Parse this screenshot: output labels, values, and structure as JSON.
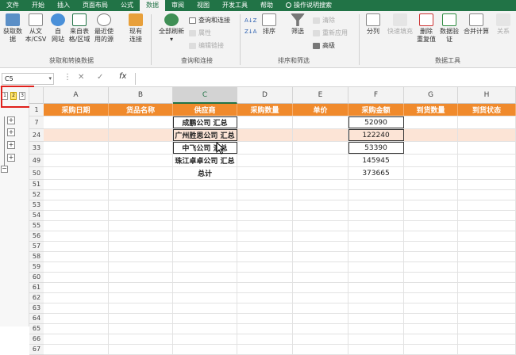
{
  "menu_tabs": [
    {
      "label": "文件",
      "active": false
    },
    {
      "label": "开始",
      "active": false
    },
    {
      "label": "插入",
      "active": false
    },
    {
      "label": "页面布局",
      "active": false
    },
    {
      "label": "公式",
      "active": false
    },
    {
      "label": "数据",
      "active": true
    },
    {
      "label": "审阅",
      "active": false
    },
    {
      "label": "视图",
      "active": false
    },
    {
      "label": "开发工具",
      "active": false
    },
    {
      "label": "帮助",
      "active": false
    }
  ],
  "tell_me": "操作说明搜索",
  "ribbon": {
    "get_data": "获取数\n据",
    "from_csv": "从文\n本/CSV",
    "from_web": "自\n网站",
    "from_table": "来自表\n格/区域",
    "recent_sources": "最近使\n用的源",
    "existing_conn": "现有\n连接",
    "group_get": "获取和转换数据",
    "refresh_all": "全部刷新",
    "queries_conn": "查询和连接",
    "properties": "属性",
    "edit_links": "编辑链接",
    "group_queries": "查询和连接",
    "sort": "排序",
    "filter": "筛选",
    "clear": "清除",
    "reapply": "重新应用",
    "advanced": "高级",
    "group_sort": "排序和筛选",
    "text_to_cols": "分列",
    "flash_fill": "快速填充",
    "remove_dup": "删除\n重复值",
    "data_valid": "数据验\n证",
    "consolidate": "合并计算",
    "relations": "关系",
    "group_tools": "数据工具"
  },
  "namebox": "C5",
  "fx": "fx",
  "outline_levels": [
    "1",
    "2",
    "3"
  ],
  "columns": [
    {
      "letter": "A",
      "selected": false
    },
    {
      "letter": "B",
      "selected": false
    },
    {
      "letter": "C",
      "selected": true
    },
    {
      "letter": "D",
      "selected": false
    },
    {
      "letter": "E",
      "selected": false
    },
    {
      "letter": "F",
      "selected": false
    },
    {
      "letter": "G",
      "selected": false
    },
    {
      "letter": "H",
      "selected": false
    }
  ],
  "headers": [
    "采购日期",
    "货品名称",
    "供应商",
    "采购数量",
    "单价",
    "采购金额",
    "到货数量",
    "到货状态"
  ],
  "summary_rows": [
    {
      "row": "7",
      "supplier": "成鹏公司 汇总",
      "amount": "52090"
    },
    {
      "row": "24",
      "supplier": "广州胜思公司 汇总",
      "amount": "122240"
    },
    {
      "row": "33",
      "supplier": "中飞公司 汇总",
      "amount": "53390"
    },
    {
      "row": "49",
      "supplier": "珠江卓卓公司 汇总",
      "amount": "145945"
    },
    {
      "row": "50",
      "supplier": "总计",
      "amount": "373665"
    }
  ],
  "empty_rows": [
    "51",
    "52",
    "53",
    "54",
    "55",
    "56",
    "57",
    "58",
    "59",
    "60",
    "61",
    "62",
    "63",
    "64",
    "65",
    "66",
    "67"
  ],
  "header_row_num": "1",
  "colors": {
    "brand": "#217346",
    "header_fill": "#f08a2c",
    "band_fill": "#fce4d6",
    "highlight": "#e0201b"
  }
}
